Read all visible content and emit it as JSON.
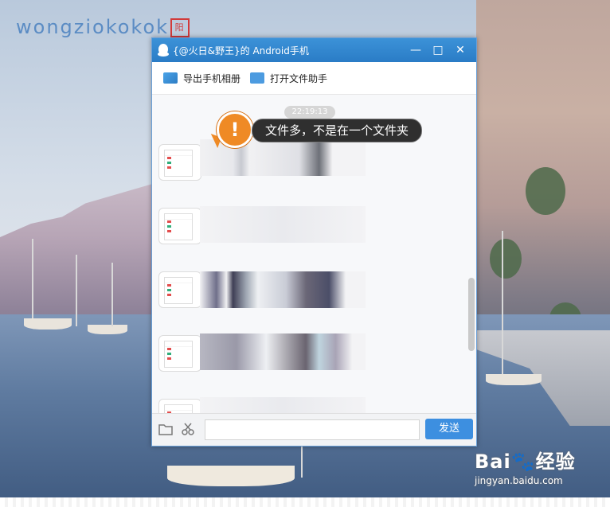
{
  "blog_watermark": {
    "text": "wongziokokok",
    "mark": "阳"
  },
  "window": {
    "title": "{@火日&野王}的 Android手机",
    "controls": {
      "minimize": "—",
      "maximize": "□",
      "close": "✕"
    }
  },
  "toolbar": {
    "export_album": "导出手机相册",
    "open_file_assistant": "打开文件助手"
  },
  "chat": {
    "timestamp": "22:19:13",
    "message_count": 5
  },
  "callout": {
    "icon": "!",
    "text": "文件多，不是在一个文件夹"
  },
  "input_bar": {
    "send_label": "发送"
  },
  "baidu_watermark": {
    "brand": "Bai",
    "paw": "🐾",
    "suffix": "经验",
    "url": "jingyan.baidu.com"
  },
  "colors": {
    "titlebar": "#2a7cc6",
    "send_button": "#3d8fe0",
    "callout_orange": "#ef8a25"
  }
}
